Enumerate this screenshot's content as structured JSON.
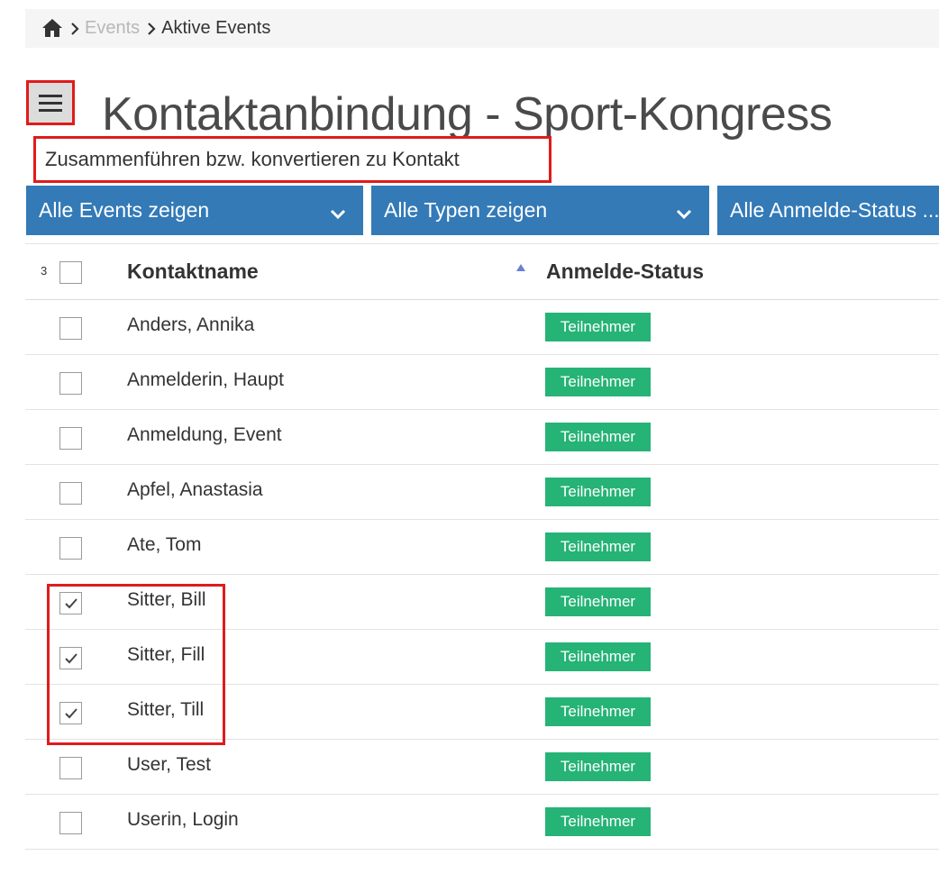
{
  "breadcrumb": {
    "home_icon": "home-icon",
    "separator_icon": "chevron-right-icon",
    "items": [
      "Events",
      "Aktive Events"
    ]
  },
  "header": {
    "menu_icon": "hamburger-menu-icon",
    "title": "Kontaktanbindung - Sport-Kongress",
    "subtitle": "Zusammenführen bzw. konvertieren zu Kontakt"
  },
  "filters": [
    {
      "label": "Alle Events zeigen",
      "icon": "chevron-down-icon"
    },
    {
      "label": "Alle Typen zeigen",
      "icon": "chevron-down-icon"
    },
    {
      "label": "Alle Anmelde-Status ..."
    }
  ],
  "table": {
    "selected_count": "3",
    "columns": {
      "name": "Kontaktname",
      "status": "Anmelde-Status"
    },
    "sort_icon": "sort-ascending-icon",
    "rows": [
      {
        "name": "Anders, Annika",
        "status": "Teilnehmer",
        "checked": false
      },
      {
        "name": "Anmelderin, Haupt",
        "status": "Teilnehmer",
        "checked": false
      },
      {
        "name": "Anmeldung, Event",
        "status": "Teilnehmer",
        "checked": false
      },
      {
        "name": "Apfel, Anastasia",
        "status": "Teilnehmer",
        "checked": false
      },
      {
        "name": "Ate, Tom",
        "status": "Teilnehmer",
        "checked": false
      },
      {
        "name": "Sitter, Bill",
        "status": "Teilnehmer",
        "checked": true
      },
      {
        "name": "Sitter, Fill",
        "status": "Teilnehmer",
        "checked": true
      },
      {
        "name": "Sitter, Till",
        "status": "Teilnehmer",
        "checked": true
      },
      {
        "name": "User, Test",
        "status": "Teilnehmer",
        "checked": false
      },
      {
        "name": "Userin, Login",
        "status": "Teilnehmer",
        "checked": false
      }
    ]
  },
  "colors": {
    "filter_bg": "#337ab7",
    "badge_bg": "#26b376",
    "highlight_border": "#e01b1b"
  }
}
